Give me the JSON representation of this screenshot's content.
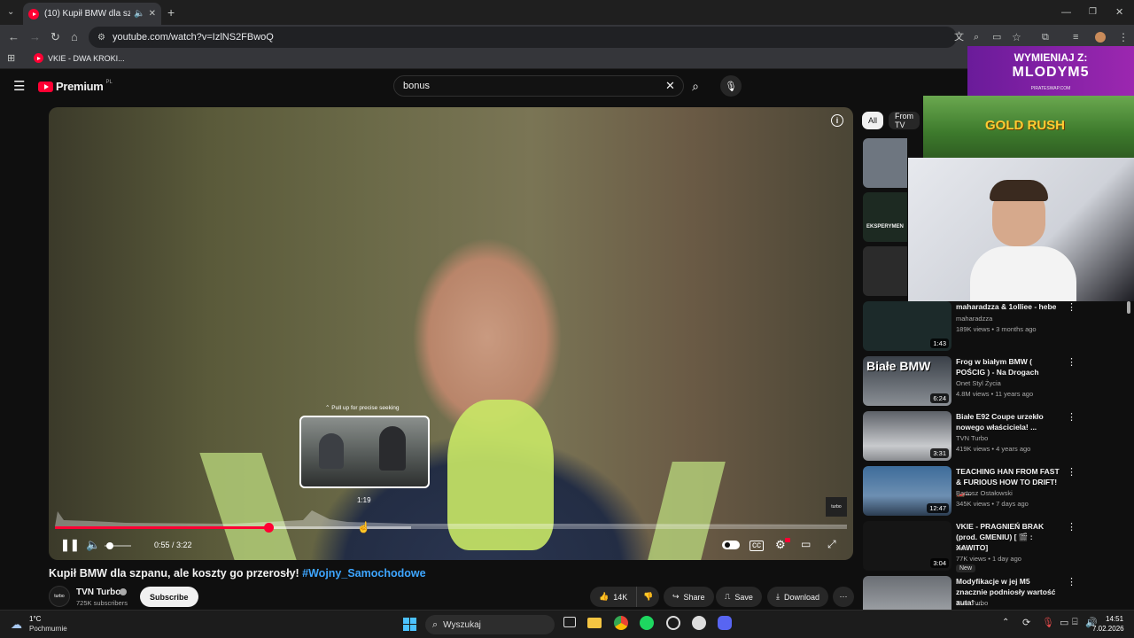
{
  "browser": {
    "tab_title": "(10) Kupił BMW dla szpanu...",
    "url": "youtube.com/watch?v=IzlNS2FBwoQ",
    "bookmark": "VKIE - DWA KROKI..."
  },
  "masthead": {
    "logo": "Premium",
    "logo_region": "PL",
    "search_value": "bonus"
  },
  "player": {
    "seek_hint": "Pull up for precise seeking",
    "preview_time": "1:19",
    "time_current": "0:55",
    "time_sep": " / ",
    "time_total": "3:22",
    "played_fraction": 0.27,
    "buffered_fraction": 0.45
  },
  "video": {
    "title_main": "Kupił BMW dla szpanu, ale koszty go przerosły!",
    "title_tag": " #Wojny_Samochodowe",
    "channel": "TVN Turbo",
    "subscribers": "725K subscribers",
    "subscribe_label": "Subscribe",
    "likes": "14K",
    "share_label": "Share",
    "save_label": "Save",
    "download_label": "Download"
  },
  "sidebar": {
    "chips": [
      "All",
      "From TV"
    ],
    "recs": [
      {
        "title": "maharadzza & 1olliee - hebe",
        "channel": "maharadzza",
        "meta": "189K views • 3 months ago",
        "duration": "1:43",
        "thumb_color": "#1c2a2a"
      },
      {
        "title": "Frog w białym BMW ( POŚCIG ) - Na Drogach",
        "channel": "Onet Styl Życia",
        "meta": "4.8M views • 11 years ago",
        "duration": "6:24",
        "thumb_text": "Białe BMW",
        "thumb_color": "#3a4048"
      },
      {
        "title": "Białe E92 Coupe urzekło nowego właściciela! ...",
        "channel": "TVN Turbo",
        "meta": "419K views • 4 years ago",
        "duration": "3:31",
        "thumb_color": "#5d6168"
      },
      {
        "title": "TEACHING HAN FROM FAST & FURIOUS HOW TO DRIFT! 🏎️...",
        "channel": "Bartosz Ostałowski",
        "meta": "345K views • 7 days ago",
        "duration": "12:47",
        "thumb_color": "#3d6c9a"
      },
      {
        "title": "VKIE - PRAGNIEŃ BRAK (prod. GMENIU) [ 🎬 : XAWITO]",
        "channel": "vkie",
        "meta": "77K views • 1 day ago",
        "duration": "3:04",
        "badge": "New",
        "thumb_color": "#151515"
      },
      {
        "title": "Modyfikacje w jej M5 znacznie podniosły wartość auta! ...",
        "channel": "TVN Turbo",
        "meta": "",
        "duration": "",
        "thumb_color": "#6a6e74"
      }
    ]
  },
  "overlays": {
    "promo_line1": "WYMIENIAJ Z:",
    "promo_line2": "MLODYM5",
    "promo_site": "PIRATESWAP.COM",
    "game_title": "GOLD RUSH"
  },
  "taskbar": {
    "weather_temp": "1°C",
    "weather_desc": "Pochmurnie",
    "search_placeholder": "Wyszukaj",
    "time": "14:51",
    "date": "7.02.2026"
  },
  "colors": {
    "yt_red": "#ff0033",
    "link_blue": "#3ea6ff"
  }
}
